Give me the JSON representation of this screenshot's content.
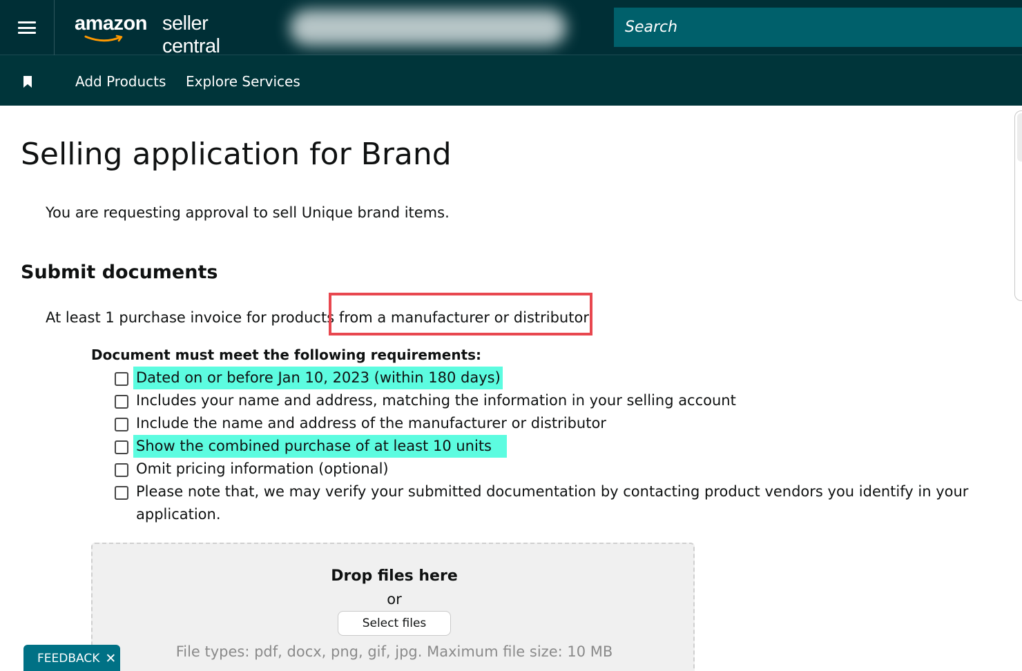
{
  "header": {
    "logo_word": "amazon",
    "logo_rest": "seller central",
    "search_placeholder": "Search"
  },
  "nav": {
    "items": [
      {
        "label": "Add Products"
      },
      {
        "label": "Explore Services"
      }
    ]
  },
  "page": {
    "title": "Selling application for Brand",
    "intro": "You are requesting approval to sell Unique brand items.",
    "section_title": "Submit documents",
    "invoice_prefix": "At least 1 purchase invoice for products",
    "invoice_suffix": "from a manufacturer or distributor",
    "requirements_heading": "Document must meet the following requirements:",
    "requirements": [
      {
        "text": "Dated on or before Jan 10, 2023 (within 180 days)",
        "highlighted": true
      },
      {
        "text": "Includes your name and address, matching the information in your selling account",
        "highlighted": false
      },
      {
        "text": "Include the name and address of the manufacturer or distributor",
        "highlighted": false
      },
      {
        "text": "Show the combined purchase of at least 10 units",
        "highlighted": true
      },
      {
        "text": "Omit pricing information (optional)",
        "highlighted": false
      },
      {
        "text": "Please note that, we may verify your submitted documentation by contacting product vendors you identify in your application.",
        "highlighted": false
      }
    ]
  },
  "upload": {
    "title": "Drop files here",
    "or": "or",
    "button": "Select files",
    "file_types": "File types: pdf, docx, png, gif, jpg. Maximum file size: 10 MB"
  },
  "feedback": {
    "label": "FEEDBACK",
    "close": "✕"
  },
  "colors": {
    "topbar": "#002f36",
    "navbar": "#00353a",
    "search": "#00606b",
    "highlight": "#5cfce0",
    "annotation": "#e8474f",
    "feedback": "#007185"
  },
  "icons": {
    "menu": "hamburger-menu-icon",
    "bookmark": "bookmark-icon",
    "logo_smile": "amazon-smile-icon",
    "close": "close-icon"
  }
}
